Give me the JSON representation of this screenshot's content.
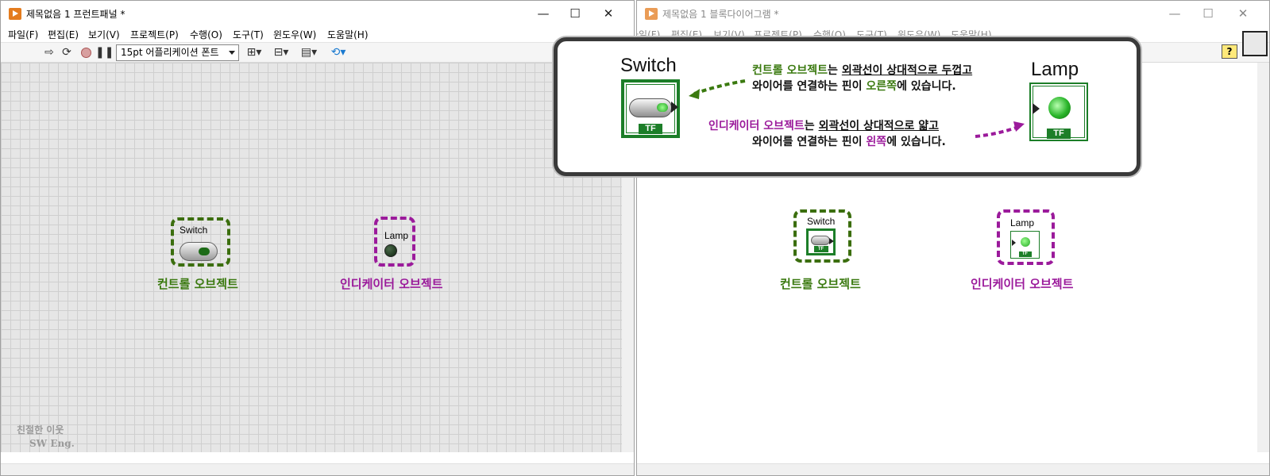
{
  "front_panel": {
    "title": "제목없음 1 프런트패널 *",
    "menu": [
      "파일(F)",
      "편집(E)",
      "보기(V)",
      "프로젝트(P)",
      "수행(O)",
      "도구(T)",
      "윈도우(W)",
      "도움말(H)"
    ],
    "font_select": "15pt 어플리케이션 폰트",
    "switch_label": "Switch",
    "lamp_label": "Lamp",
    "control_caption": "컨트롤 오브젝트",
    "indicator_caption": "인디케이터 오브젝트"
  },
  "block_diagram": {
    "title": "제목없음 1 블록다이어그램 *",
    "menu": [
      "파일(F)",
      "편집(E)",
      "보기(V)",
      "프로젝트(P)",
      "수행(O)",
      "도구(T)",
      "윈도우(W)",
      "도움말(H)"
    ],
    "switch_label": "Switch",
    "lamp_label": "Lamp",
    "tf": "TF",
    "control_caption": "컨트롤 오브젝트",
    "indicator_caption": "인디케이터 오브젝트",
    "help_icon": "?"
  },
  "callout": {
    "switch_label": "Switch",
    "lamp_label": "Lamp",
    "tf": "TF",
    "control_line1_a": "컨트롤 오브젝트",
    "control_line1_b": "는 ",
    "control_line1_c": "외곽선이 상대적으로 두껍고",
    "control_line2_a": "와이어를 연결하는 핀이 ",
    "control_line2_b": "오른쪽",
    "control_line2_c": "에 있습니다.",
    "indicator_line1_a": "인디케이터 오브젝트",
    "indicator_line1_b": "는 ",
    "indicator_line1_c": "외곽선이 상대적으로 얇고",
    "indicator_line2_a": "와이어를 연결하는 핀이 ",
    "indicator_line2_b": "왼쪽",
    "indicator_line2_c": "에 있습니다."
  },
  "watermark": {
    "line1": "친절한 이웃",
    "line2": "SW Eng."
  },
  "colors": {
    "control": "#3b7a10",
    "indicator": "#9b1a9b",
    "terminal": "#1c7e28"
  },
  "window_controls": {
    "minimize": "—",
    "maximize": "☐",
    "close": "✕"
  }
}
